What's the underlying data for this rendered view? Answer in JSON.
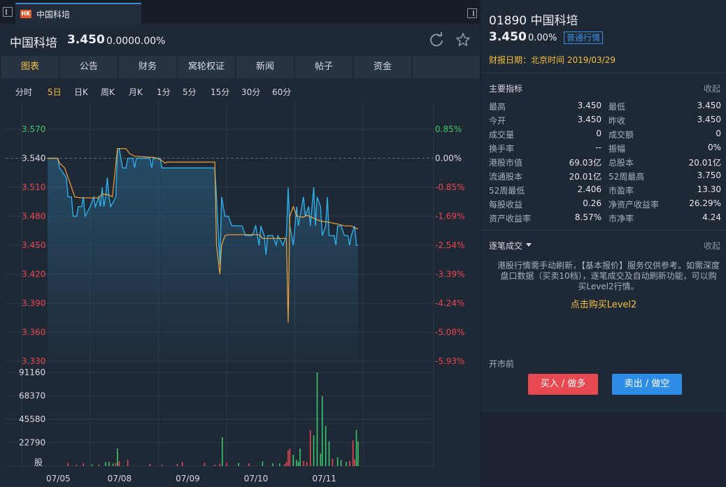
{
  "tab": {
    "badge": "HK",
    "title": "中国科培"
  },
  "quote": {
    "name": "中国科培",
    "price": "3.450",
    "change": "0.000",
    "pct": "0.00%"
  },
  "nav_tabs": [
    "图表",
    "公告",
    "财务",
    "窝轮权证",
    "新闻",
    "帖子",
    "资金"
  ],
  "periods": [
    "分时",
    "5日",
    "日K",
    "周K",
    "月K",
    "1分",
    "5分",
    "15分",
    "30分",
    "60分"
  ],
  "active_period": "5日",
  "right": {
    "code_name": "01890 中国科培",
    "price": "3.450",
    "pct": "0.00%",
    "quote_type": "普通行情",
    "report_date": "财报日期：北京时间 2019/03/29",
    "section1_title": "主要指标",
    "collapse": "收起",
    "indicators": [
      [
        "最高",
        "3.450",
        "最低",
        "3.450"
      ],
      [
        "今开",
        "3.450",
        "昨收",
        "3.450"
      ],
      [
        "成交量",
        "0",
        "成交额",
        "0"
      ],
      [
        "换手率",
        "--",
        "振幅",
        "0%"
      ],
      [
        "港股市值",
        "69.03亿",
        "总股本",
        "20.01亿"
      ],
      [
        "流通股本",
        "20.01亿",
        "52周最高",
        "3.750"
      ],
      [
        "52周最低",
        "2.406",
        "市盈率",
        "13.30"
      ],
      [
        "每股收益",
        "0.26",
        "净资产收益率",
        "26.29%"
      ],
      [
        "资产收益率",
        "8.57%",
        "市净率",
        "4.24"
      ]
    ],
    "section2_title": "逐笔成交",
    "notice": "港股行情需手动刷新，【基本报价】服务仅供参考。如需深度盘口数据（买卖10档），逐笔成交及自动刷新功能，可以购买Level2行情。",
    "buy_level2": "点击购买Level2",
    "premarket": "开市前",
    "buy": "买入 / 做多",
    "sell": "卖出 / 做空"
  },
  "colors": {
    "price_line": "#2eaee8",
    "avg_line": "#f0a43a",
    "up": "#e84850",
    "down": "#3cc768",
    "accent": "#f4c13c"
  },
  "chart_data": {
    "type": "line",
    "days": [
      "07/05",
      "07/08",
      "07/09",
      "07/10",
      "07/11"
    ],
    "price_axis": {
      "ticks": [
        "3.570",
        "3.540",
        "3.510",
        "3.480",
        "3.450",
        "3.420",
        "3.390",
        "3.360",
        "3.330"
      ],
      "ylim": [
        3.33,
        3.57
      ],
      "ref": 3.54
    },
    "pct_axis": [
      "0.85%",
      "0.00%",
      "-0.85%",
      "-1.69%",
      "-2.54%",
      "-3.39%",
      "-4.24%",
      "-5.08%",
      "-5.93%"
    ],
    "volume_axis": {
      "ticks": [
        "91160",
        "68370",
        "45580",
        "22790"
      ],
      "unit": "股",
      "ymax": 91160
    },
    "price": [
      [
        0.0,
        3.54
      ],
      [
        0.3,
        3.54
      ],
      [
        0.35,
        3.53
      ],
      [
        0.55,
        3.52
      ],
      [
        0.6,
        3.5
      ],
      [
        0.7,
        3.5
      ],
      [
        0.75,
        3.48
      ],
      [
        0.85,
        3.48
      ],
      [
        0.9,
        3.49
      ],
      [
        1.0,
        3.49
      ],
      [
        1.05,
        3.5
      ],
      [
        1.1,
        3.48
      ],
      [
        1.25,
        3.49
      ],
      [
        1.35,
        3.5
      ],
      [
        1.4,
        3.49
      ],
      [
        1.5,
        3.5
      ],
      [
        1.55,
        3.49
      ],
      [
        1.6,
        3.51
      ],
      [
        1.65,
        3.49
      ],
      [
        1.7,
        3.5
      ],
      [
        1.75,
        3.52
      ],
      [
        1.8,
        3.5
      ],
      [
        1.85,
        3.49
      ],
      [
        2.0,
        3.5
      ],
      [
        2.05,
        3.55
      ],
      [
        2.1,
        3.55
      ],
      [
        2.2,
        3.53
      ],
      [
        2.3,
        3.53
      ],
      [
        2.35,
        3.54
      ],
      [
        2.5,
        3.54
      ],
      [
        2.55,
        3.53
      ],
      [
        2.6,
        3.54
      ],
      [
        3.0,
        3.54
      ],
      [
        3.05,
        3.53
      ],
      [
        3.1,
        3.54
      ],
      [
        3.3,
        3.54
      ],
      [
        3.35,
        3.53
      ],
      [
        4.9,
        3.53
      ],
      [
        4.95,
        3.5
      ],
      [
        5.05,
        3.43
      ],
      [
        5.1,
        3.5
      ],
      [
        5.2,
        3.48
      ],
      [
        5.3,
        3.48
      ],
      [
        5.4,
        3.47
      ],
      [
        5.7,
        3.47
      ],
      [
        5.8,
        3.46
      ],
      [
        6.0,
        3.46
      ],
      [
        6.1,
        3.47
      ],
      [
        6.2,
        3.45
      ],
      [
        6.25,
        3.47
      ],
      [
        6.35,
        3.46
      ],
      [
        6.4,
        3.44
      ],
      [
        6.45,
        3.46
      ],
      [
        6.6,
        3.46
      ],
      [
        6.7,
        3.45
      ],
      [
        6.75,
        3.46
      ],
      [
        6.9,
        3.45
      ],
      [
        7.0,
        3.46
      ],
      [
        7.05,
        3.51
      ],
      [
        7.1,
        3.47
      ],
      [
        7.15,
        3.46
      ],
      [
        7.2,
        3.45
      ],
      [
        7.3,
        3.49
      ],
      [
        7.35,
        3.47
      ],
      [
        7.4,
        3.48
      ],
      [
        7.5,
        3.5
      ],
      [
        7.55,
        3.48
      ],
      [
        7.65,
        3.49
      ],
      [
        7.7,
        3.47
      ],
      [
        7.75,
        3.49
      ],
      [
        7.8,
        3.51
      ],
      [
        7.85,
        3.47
      ],
      [
        7.9,
        3.5
      ],
      [
        8.0,
        3.49
      ],
      [
        8.05,
        3.46
      ],
      [
        8.15,
        3.47
      ],
      [
        8.2,
        3.5
      ],
      [
        8.25,
        3.46
      ],
      [
        8.4,
        3.46
      ],
      [
        8.45,
        3.45
      ],
      [
        8.5,
        3.47
      ],
      [
        8.6,
        3.47
      ],
      [
        8.7,
        3.46
      ],
      [
        8.8,
        3.46
      ],
      [
        8.85,
        3.45
      ],
      [
        8.9,
        3.46
      ],
      [
        9.0,
        3.47
      ],
      [
        9.05,
        3.45
      ],
      [
        9.1,
        3.45
      ]
    ],
    "avg": [
      [
        0.0,
        3.54
      ],
      [
        0.3,
        3.54
      ],
      [
        0.35,
        3.535
      ],
      [
        0.5,
        3.53
      ],
      [
        0.6,
        3.52
      ],
      [
        0.7,
        3.51
      ],
      [
        0.8,
        3.5
      ],
      [
        1.0,
        3.499
      ],
      [
        1.5,
        3.499
      ],
      [
        1.6,
        3.503
      ],
      [
        1.8,
        3.502
      ],
      [
        1.9,
        3.5
      ],
      [
        2.05,
        3.55
      ],
      [
        2.3,
        3.55
      ],
      [
        2.4,
        3.545
      ],
      [
        2.55,
        3.542
      ],
      [
        2.6,
        3.542
      ],
      [
        3.0,
        3.541
      ],
      [
        3.1,
        3.541
      ],
      [
        3.3,
        3.539
      ],
      [
        3.4,
        3.536
      ],
      [
        3.45,
        3.535
      ],
      [
        3.5,
        3.536
      ],
      [
        4.9,
        3.536
      ],
      [
        4.95,
        3.45
      ],
      [
        5.05,
        3.42
      ],
      [
        5.1,
        3.45
      ],
      [
        5.2,
        3.46
      ],
      [
        5.3,
        3.461
      ],
      [
        5.6,
        3.461
      ],
      [
        6.2,
        3.461
      ],
      [
        6.3,
        3.457
      ],
      [
        6.5,
        3.457
      ],
      [
        7.0,
        3.457
      ],
      [
        7.05,
        3.37
      ],
      [
        7.1,
        3.48
      ],
      [
        7.2,
        3.49
      ],
      [
        7.3,
        3.48
      ],
      [
        7.5,
        3.479
      ],
      [
        7.6,
        3.481
      ],
      [
        7.8,
        3.478
      ],
      [
        8.0,
        3.475
      ],
      [
        8.2,
        3.474
      ],
      [
        8.5,
        3.472
      ],
      [
        8.7,
        3.47
      ],
      [
        8.9,
        3.47
      ],
      [
        9.0,
        3.468
      ],
      [
        9.1,
        3.467
      ]
    ],
    "volume": [
      [
        0.6,
        3000,
        "up"
      ],
      [
        0.85,
        1500,
        "up"
      ],
      [
        1.05,
        2500,
        "up"
      ],
      [
        1.3,
        1500,
        "down"
      ],
      [
        1.5,
        1500,
        "up"
      ],
      [
        1.7,
        4000,
        "down"
      ],
      [
        1.8,
        4000,
        "down"
      ],
      [
        1.92,
        2500,
        "down"
      ],
      [
        2.0,
        3000,
        "up"
      ],
      [
        2.05,
        17000,
        "down"
      ],
      [
        2.1,
        5000,
        "up"
      ],
      [
        2.35,
        6000,
        "up"
      ],
      [
        3.0,
        2000,
        "up"
      ],
      [
        3.35,
        1500,
        "up"
      ],
      [
        3.8,
        2000,
        "up"
      ],
      [
        3.95,
        4000,
        "up"
      ],
      [
        4.6,
        3000,
        "up"
      ],
      [
        4.9,
        1500,
        "up"
      ],
      [
        5.05,
        2500,
        "up"
      ],
      [
        5.12,
        28000,
        "down"
      ],
      [
        5.25,
        3000,
        "up"
      ],
      [
        5.6,
        3000,
        "down"
      ],
      [
        5.9,
        2500,
        "up"
      ],
      [
        6.3,
        4500,
        "down"
      ],
      [
        6.6,
        2500,
        "down"
      ],
      [
        6.8,
        2500,
        "down"
      ],
      [
        6.95,
        2000,
        "up"
      ],
      [
        7.0,
        4000,
        "up"
      ],
      [
        7.05,
        15000,
        "up"
      ],
      [
        7.1,
        17000,
        "up"
      ],
      [
        7.2,
        11000,
        "down"
      ],
      [
        7.3,
        6000,
        "down"
      ],
      [
        7.35,
        4000,
        "down"
      ],
      [
        7.4,
        17000,
        "down"
      ],
      [
        7.5,
        5000,
        "up"
      ],
      [
        7.6,
        4000,
        "up"
      ],
      [
        7.7,
        35000,
        "up"
      ],
      [
        7.8,
        30000,
        "down"
      ],
      [
        7.9,
        91160,
        "down"
      ],
      [
        8.0,
        12000,
        "down"
      ],
      [
        8.05,
        68000,
        "down"
      ],
      [
        8.15,
        39000,
        "down"
      ],
      [
        8.25,
        24000,
        "down"
      ],
      [
        8.35,
        7000,
        "up"
      ],
      [
        8.5,
        8500,
        "down"
      ],
      [
        8.6,
        6000,
        "down"
      ],
      [
        8.75,
        4000,
        "down"
      ],
      [
        8.85,
        5000,
        "up"
      ],
      [
        8.95,
        25000,
        "up"
      ],
      [
        9.0,
        6500,
        "up"
      ],
      [
        9.05,
        35000,
        "down"
      ],
      [
        9.1,
        24000,
        "down"
      ]
    ]
  }
}
